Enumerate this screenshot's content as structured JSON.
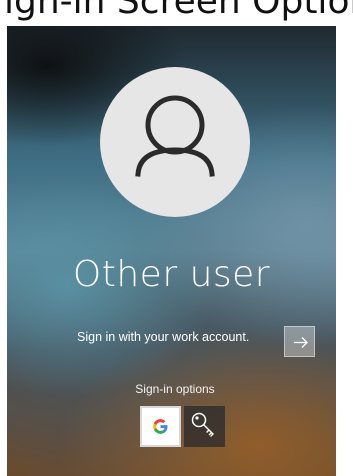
{
  "caption": {
    "text": "ign-in Screen Options"
  },
  "login": {
    "username": "Other user",
    "prompt": "Sign in with your work account.",
    "submit_icon": "arrow-right-icon",
    "options_label": "Sign-in options",
    "options": [
      {
        "name": "Google",
        "icon": "google-logo-icon",
        "selected": true
      },
      {
        "name": "Security key",
        "icon": "key-icon",
        "selected": false
      }
    ]
  },
  "colors": {
    "google_blue": "#4285F4",
    "google_red": "#EA4335",
    "google_yellow": "#FBBC05",
    "google_green": "#34A853",
    "avatar_bg": "#e6e6e6",
    "avatar_glyph": "#2b2b2b"
  }
}
